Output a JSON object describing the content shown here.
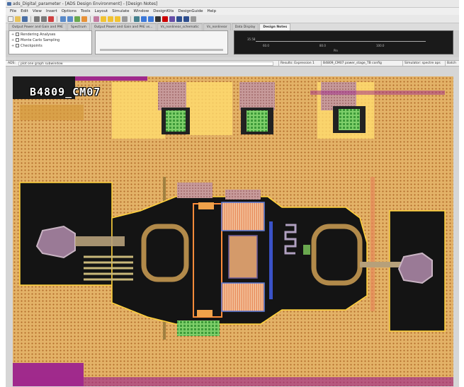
{
  "window": {
    "title": "ads_Digital_parameter - [ADS Design Environment] - [Design Notes]"
  },
  "menu": [
    "File",
    "Edit",
    "View",
    "Insert",
    "Options",
    "Tools",
    "Layout",
    "Simulate",
    "Window",
    "DesignKits",
    "DesignGuide",
    "Help"
  ],
  "tabs": [
    {
      "label": "Output Power and Gain and PAE"
    },
    {
      "label": "Spectrum"
    },
    {
      "label": "Output Power and Gain and PAE vs..."
    },
    {
      "label": "Vs_nonlinear_schematic"
    },
    {
      "label": "Vs_nonlinear"
    },
    {
      "label": "Data Display"
    },
    {
      "label": "Design Notes"
    }
  ],
  "tree": {
    "items": [
      {
        "label": "Rendering Analyses"
      },
      {
        "label": "Monte Carlo Sampling"
      },
      {
        "label": "Checkpoints"
      }
    ]
  },
  "plot": {
    "readout_left": "35.58",
    "tick1": "60.0",
    "tick2": "80.0",
    "tick3": "100.0",
    "unit": "Pin"
  },
  "command": {
    "prefix": "ADS:",
    "value": "plot one graph subwindow"
  },
  "status": {
    "s1": "Results: Expression 1",
    "s2": "B4809_CM07 power_stage_TB config",
    "s3": "Simulator: spectre aps",
    "s4": "Batch"
  },
  "layout": {
    "cell_name": "B4809_CM07"
  },
  "colors": {
    "substrate": "#e3b267",
    "metal_top": "#ffdc6e",
    "metal_dark": "#141414",
    "boundary": "#a02a8c",
    "via_green": "#5fbf55",
    "inductor": "#b28a4a"
  }
}
